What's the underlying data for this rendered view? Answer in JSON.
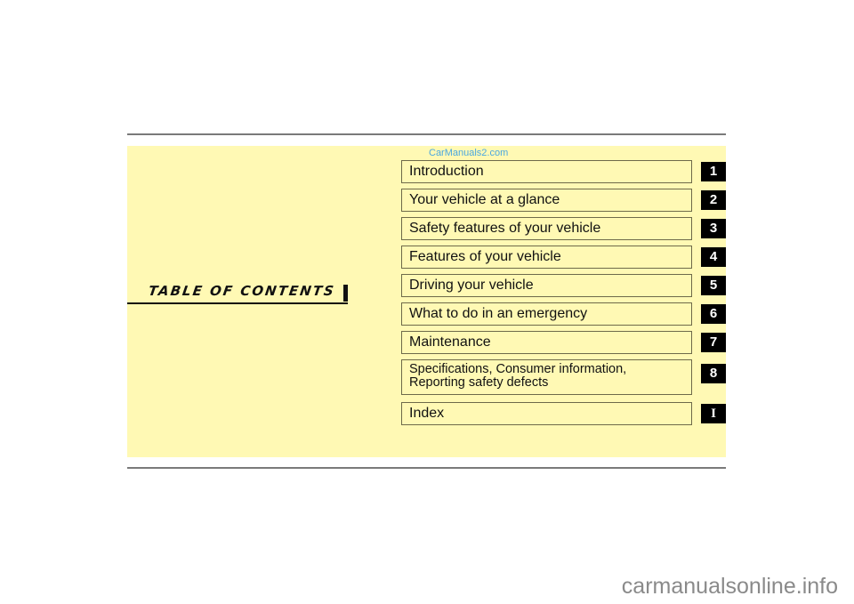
{
  "watermarks": {
    "top": "CarManuals2.com",
    "bottom": "carmanualsonline.info"
  },
  "toc": {
    "title": "TABLE OF CONTENTS",
    "entries": [
      {
        "label": "Introduction",
        "chapter": "1"
      },
      {
        "label": "Your vehicle at a glance",
        "chapter": "2"
      },
      {
        "label": "Safety features of your vehicle",
        "chapter": "3"
      },
      {
        "label": "Features of your vehicle",
        "chapter": "4"
      },
      {
        "label": "Driving your vehicle",
        "chapter": "5"
      },
      {
        "label": "What to do in an emergency",
        "chapter": "6"
      },
      {
        "label": "Maintenance",
        "chapter": "7"
      },
      {
        "label": "Specifications, Consumer information,\nReporting safety defects",
        "chapter": "8"
      },
      {
        "label": "Index",
        "chapter": "I"
      }
    ]
  },
  "colors": {
    "panel": "#fff9b4",
    "badge": "#000000",
    "rule": "#7a7a7a",
    "watermark_top": "#4aa8e0"
  }
}
